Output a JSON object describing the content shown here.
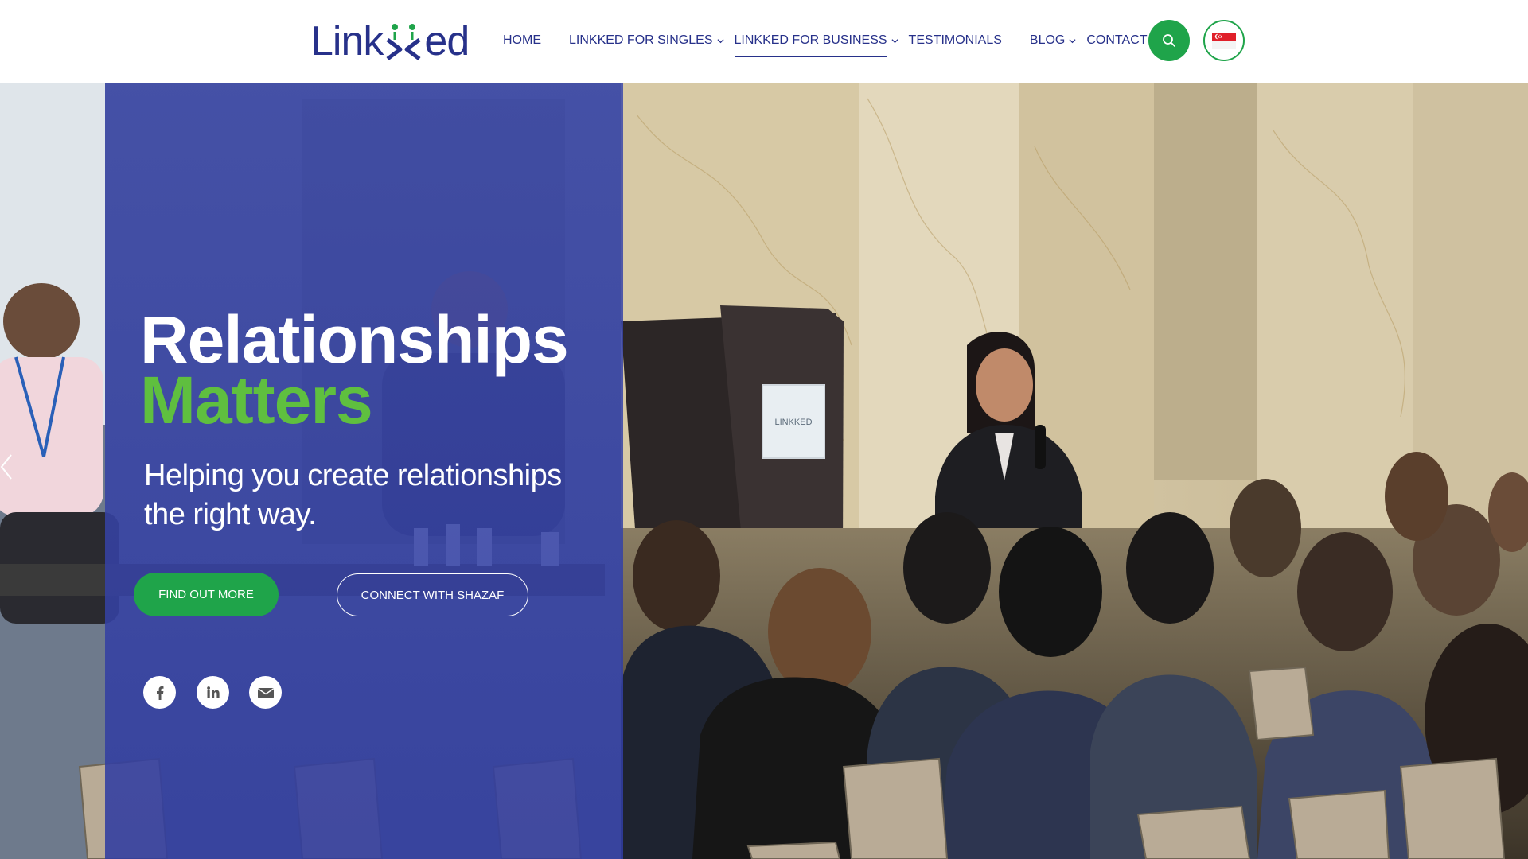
{
  "header": {
    "logo_text_left": "Link",
    "logo_text_right": "ed",
    "nav": [
      {
        "label": "HOME",
        "has_dropdown": false,
        "active": false
      },
      {
        "label": "LINKKED FOR SINGLES",
        "has_dropdown": true,
        "active": false
      },
      {
        "label": "LINKKED FOR BUSINESS",
        "has_dropdown": true,
        "active": true
      },
      {
        "label": "TESTIMONIALS",
        "has_dropdown": false,
        "active": false
      },
      {
        "label": "BLOG",
        "has_dropdown": true,
        "active": false
      },
      {
        "label": "CONTACT",
        "has_dropdown": false,
        "active": false
      }
    ],
    "search_icon": "search-icon",
    "flag_icon": "singapore-flag-icon"
  },
  "hero": {
    "title_line1": "Relationships",
    "title_line2": "Matters",
    "subtitle_line1": "Helping you create relationships",
    "subtitle_line2": "the right way.",
    "primary_button": "FIND OUT MORE",
    "secondary_button": "CONNECT WITH SHAZAF",
    "social": [
      {
        "name": "facebook-icon"
      },
      {
        "name": "linkedin-icon"
      },
      {
        "name": "email-icon"
      }
    ],
    "podium_sign": "LINKKED"
  },
  "colors": {
    "brand_blue": "#27318a",
    "brand_green": "#1fa44a",
    "headline_green": "#5fbf3f",
    "panel_blue": "#3e4aaa"
  }
}
